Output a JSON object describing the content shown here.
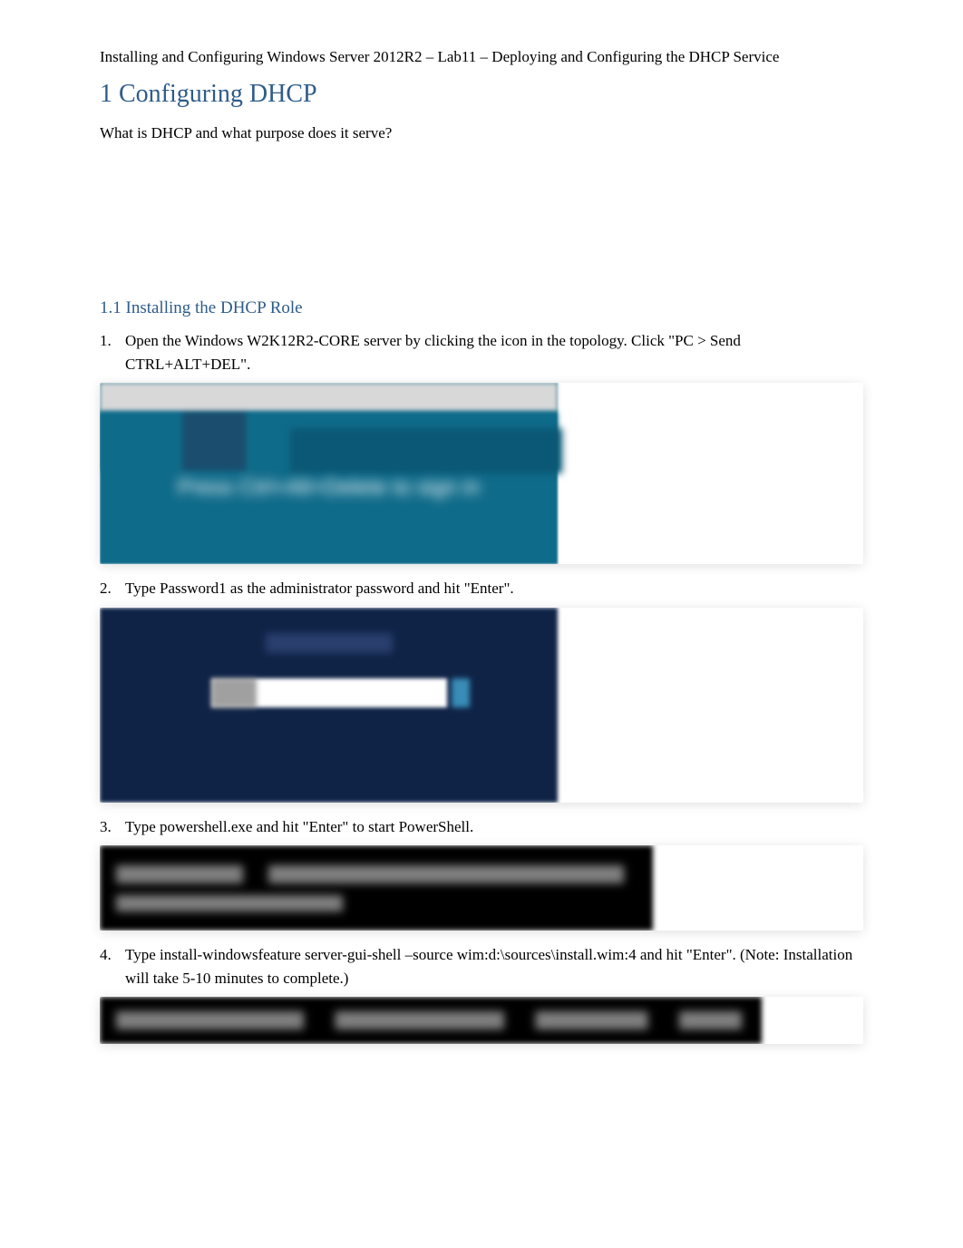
{
  "header": "Installing and Configuring Windows Server 2012R2 – Lab11 – Deploying and Configuring the DHCP Service",
  "section1": {
    "title": "1 Configuring DHCP",
    "intro": "What is DHCP and what purpose does it serve?"
  },
  "section1_1": {
    "title": "1.1 Installing the DHCP Role",
    "steps": [
      "Open the Windows W2K12R2-CORE server by clicking the icon in the topology. Click \"PC > Send CTRL+ALT+DEL\".",
      "Type Password1  as the administrator password and hit \"Enter\".",
      "Type powershell.exe   and hit \"Enter\" to start PowerShell.",
      "Type install-windowsfeature server-gui-shell –source wim:d:\\sources\\install.wim:4       and hit \"Enter\". (Note: Installation will take 5-10 minutes to complete.)"
    ]
  },
  "screenshots": {
    "s1_text": "Press Ctrl+Alt+Delete to sign in"
  }
}
